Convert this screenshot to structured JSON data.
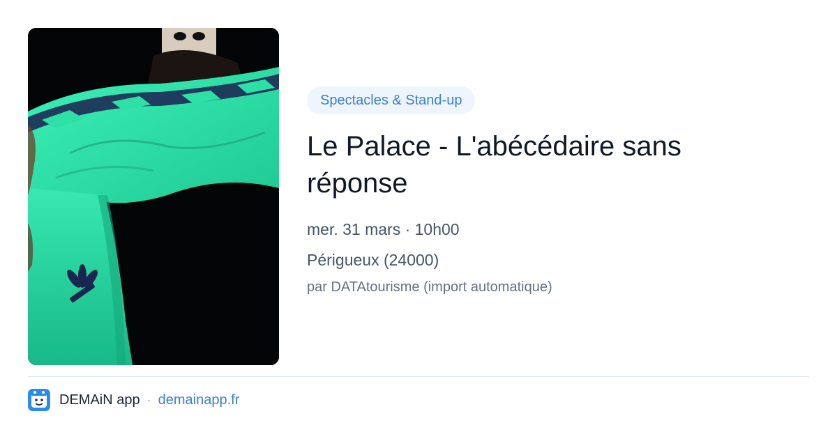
{
  "event": {
    "image_alt": "Performer in a green tracksuit",
    "category": "Spectacles & Stand-up",
    "title": "Le Palace - L'abécédaire sans réponse",
    "datetime": "mer. 31 mars · 10h00",
    "location": "Périgueux (24000)",
    "source": "par DATAtourisme (import automatique)"
  },
  "footer": {
    "app_name": "DEMAiN app",
    "separator": "·",
    "site": "demainapp.fr"
  },
  "colors": {
    "accent": "#3b7fd3",
    "pill_bg": "#eef5fd",
    "tracksuit": "#2ee0a6"
  },
  "icons": {
    "app_logo": "demain-app-logo-icon"
  }
}
